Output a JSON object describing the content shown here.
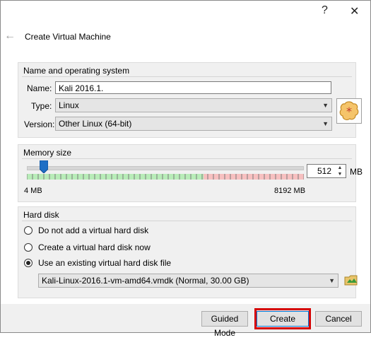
{
  "titlebar": {
    "help_label": "?",
    "close_label": "✕"
  },
  "wizard": {
    "back_icon": "arrow-left-icon",
    "title": "Create Virtual Machine"
  },
  "name_os": {
    "group_title": "Name and operating system",
    "name_label": "Name:",
    "name_value": "Kali 2016.1.",
    "type_label": "Type:",
    "type_value": "Linux",
    "version_label": "Version:",
    "version_value": "Other Linux (64-bit)",
    "os_icon": "linux-os-icon"
  },
  "memory": {
    "group_title": "Memory size",
    "value": "512",
    "unit": "MB",
    "min_label": "4 MB",
    "max_label": "8192 MB",
    "slider_fraction": 0.062
  },
  "hard_disk": {
    "group_title": "Hard disk",
    "options": [
      {
        "label": "Do not add a virtual hard disk",
        "checked": false
      },
      {
        "label": "Create a virtual hard disk now",
        "checked": false
      },
      {
        "label": "Use an existing virtual hard disk file",
        "checked": true
      }
    ],
    "file_value": "Kali-Linux-2016.1-vm-amd64.vmdk (Normal, 30.00 GB)",
    "browse_icon": "folder-browse-icon"
  },
  "buttons": {
    "guided": "Guided Mode",
    "create": "Create",
    "cancel": "Cancel"
  },
  "colors": {
    "slider_green": "#9fdf9f",
    "slider_red": "#f4a6a6",
    "highlight": "#d50000"
  }
}
